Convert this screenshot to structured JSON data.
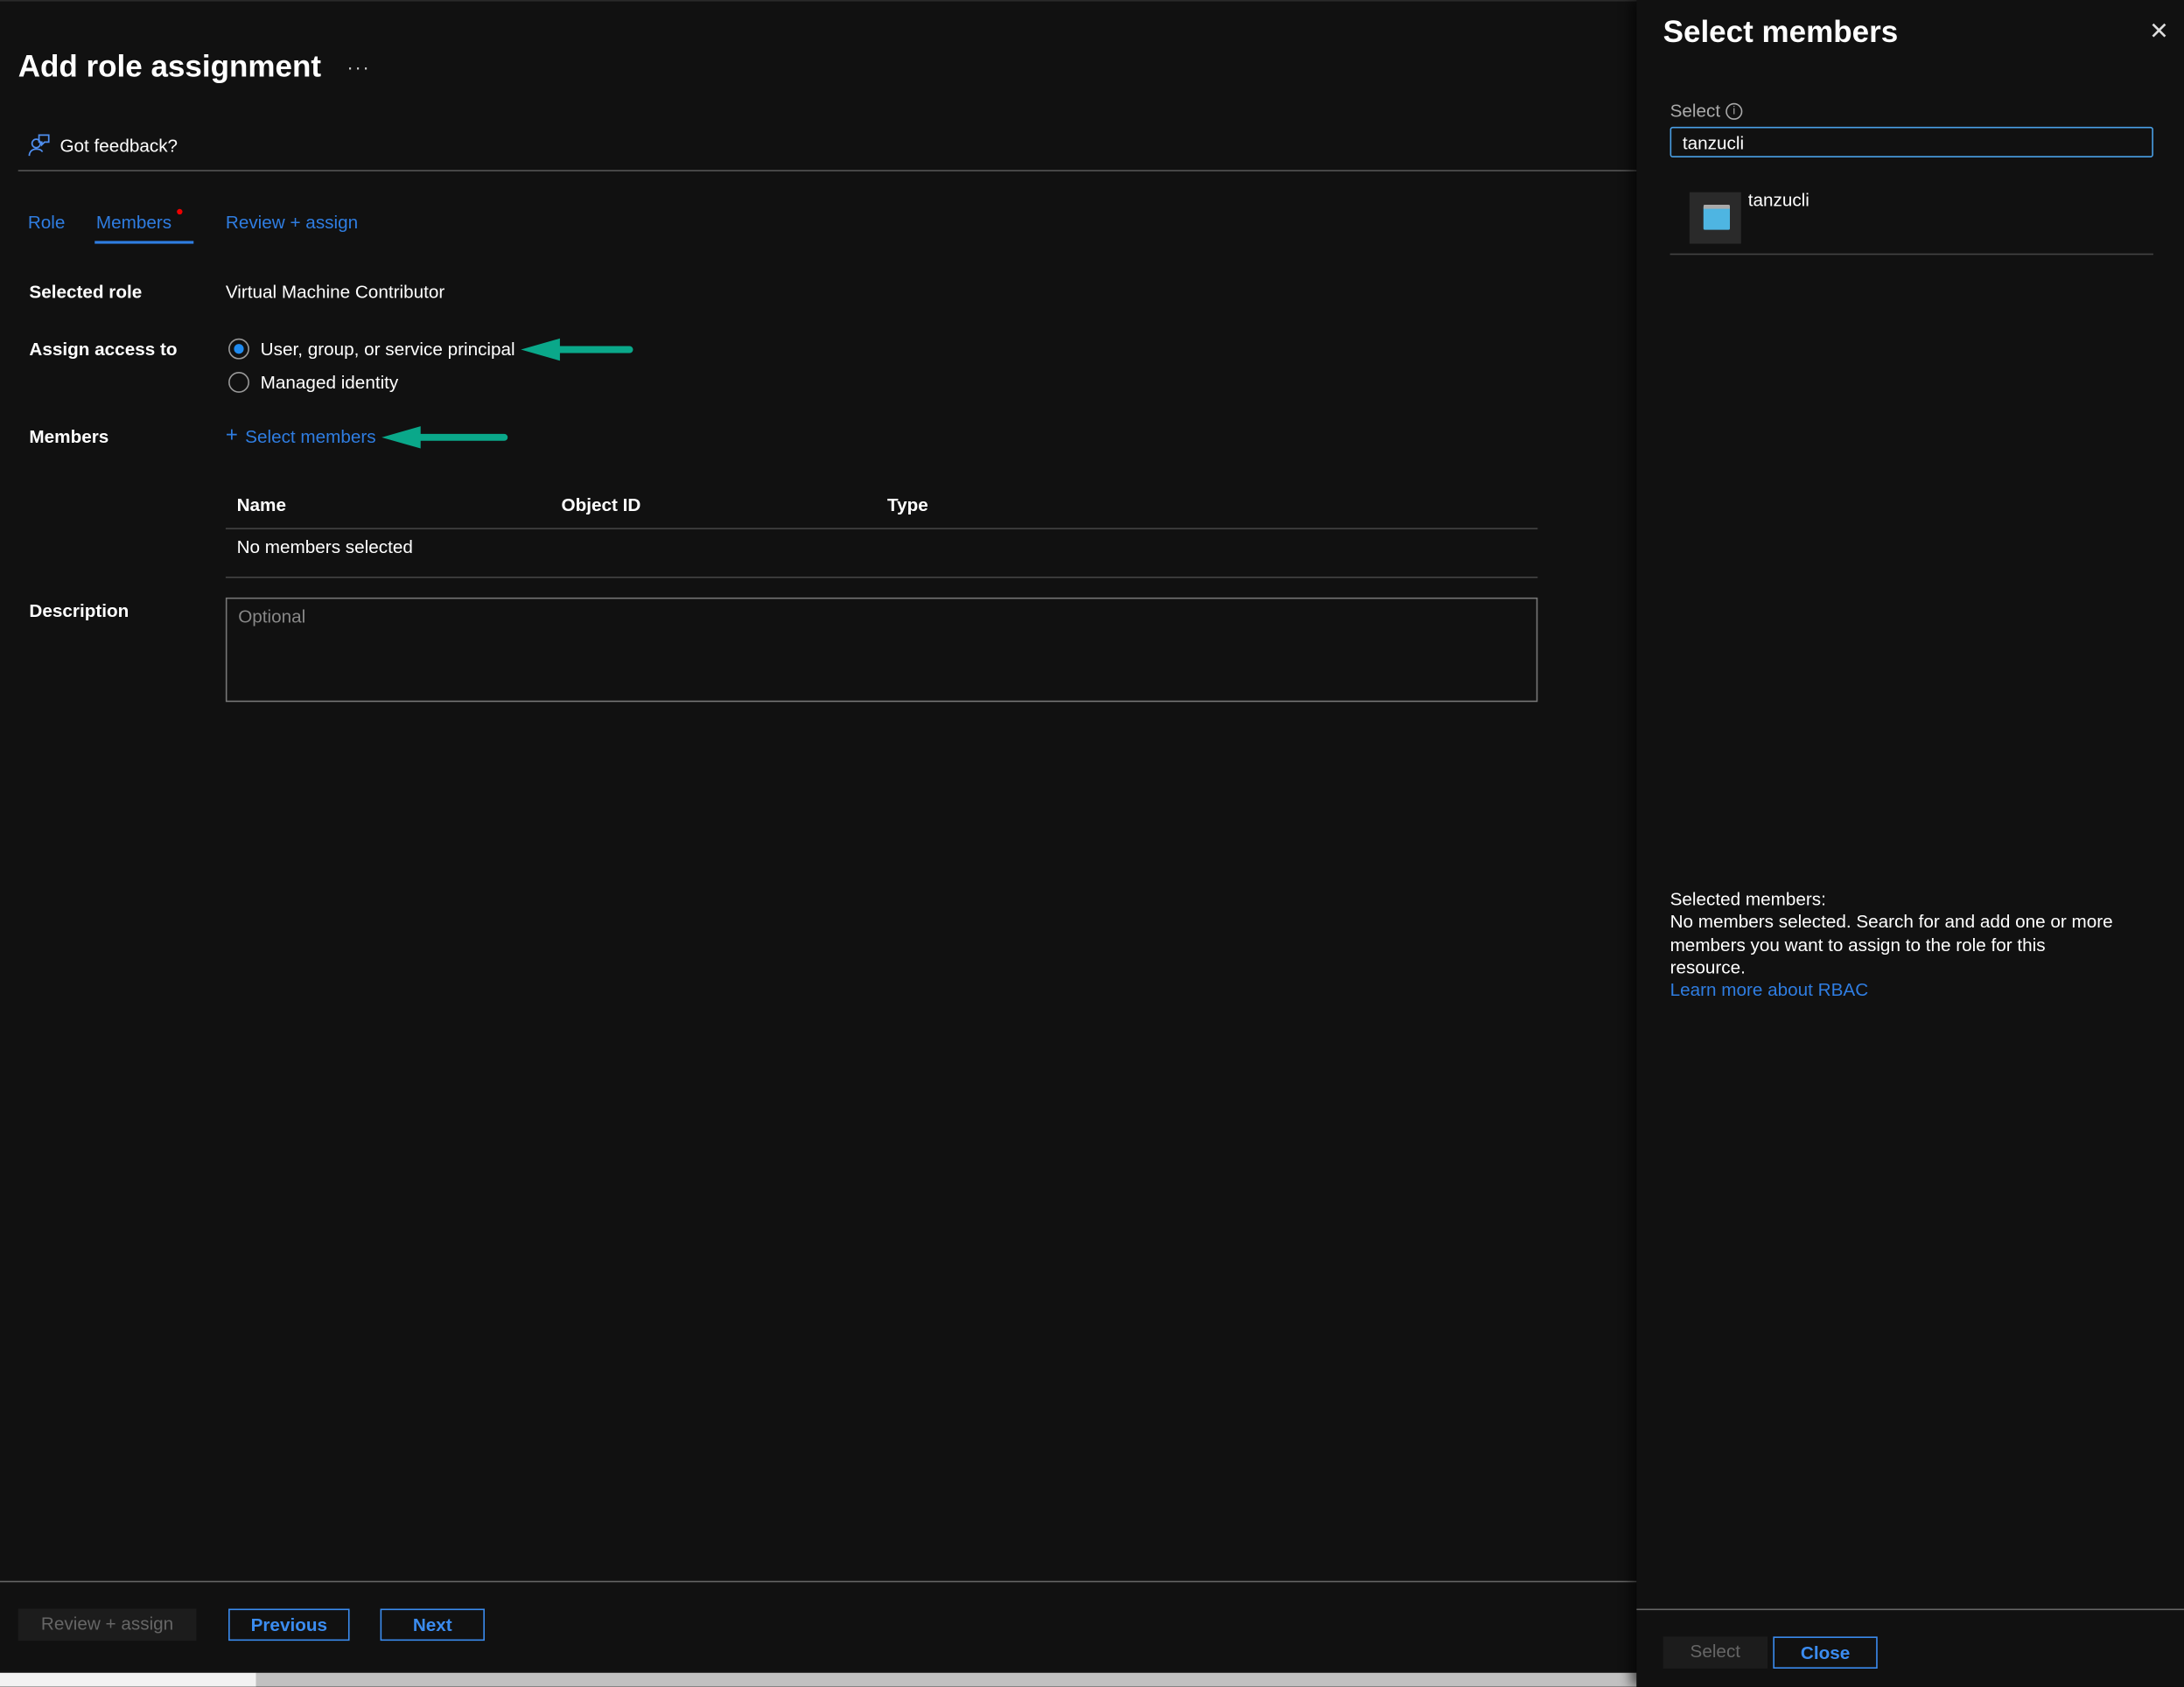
{
  "header": {
    "title": "Add role assignment",
    "more_label": "···",
    "feedback": "Got feedback?"
  },
  "tabs": [
    {
      "label": "Role"
    },
    {
      "label": "Members",
      "active": true
    },
    {
      "label": "Review + assign"
    }
  ],
  "form": {
    "selected_role_label": "Selected role",
    "selected_role_value": "Virtual Machine Contributor",
    "assign_access_label": "Assign access to",
    "assign_options": [
      {
        "label": "User, group, or service principal",
        "checked": true
      },
      {
        "label": "Managed identity",
        "checked": false
      }
    ],
    "members_label": "Members",
    "select_members": "Select members",
    "plus": "+",
    "table": {
      "columns": [
        "Name",
        "Object ID",
        "Type"
      ],
      "empty": "No members selected"
    },
    "description_label": "Description",
    "description_placeholder": "Optional"
  },
  "footer": {
    "review_assign": "Review + assign",
    "previous": "Previous",
    "next": "Next"
  },
  "panel": {
    "title": "Select members",
    "close_glyph": "✕",
    "select_label": "Select",
    "search_value": "tanzucli",
    "results": [
      {
        "name": "tanzucli"
      }
    ],
    "selected_heading": "Selected members:",
    "selected_text": "No members selected. Search for and add one or more members you want to assign to the role for this resource.",
    "learn_more": "Learn more about RBAC",
    "select_button": "Select",
    "close_button": "Close"
  },
  "colors": {
    "accent": "#2f7de1",
    "arrow": "#0aa88a",
    "background": "#111111"
  }
}
